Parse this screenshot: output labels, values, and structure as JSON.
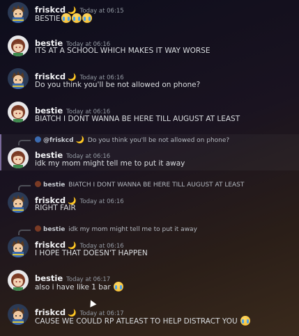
{
  "messages": [
    {
      "user": "friskcd",
      "moon": "🌙",
      "timestamp": "Today at 06:15",
      "text": "BESTIE",
      "emoji_count": 3
    },
    {
      "user": "bestie",
      "timestamp": "Today at 06:16",
      "text": "ITS AT A SCHOOL WHICH MAKES IT WAY WORSE"
    },
    {
      "user": "friskcd",
      "moon": "🌙",
      "timestamp": "Today at 06:16",
      "text": "Do you think you'll be not allowed on phone?"
    },
    {
      "user": "bestie",
      "timestamp": "Today at 06:16",
      "text": "BIATCH I DONT WANNA BE HERE TILL AUGUST AT LEAST"
    },
    {
      "reply_user": "@friskcd",
      "reply_moon": "🌙",
      "reply_text": "Do you think you'll be not allowed on phone?",
      "user": "bestie",
      "timestamp": "Today at 06:16",
      "text": "idk my mom might tell me to put it away"
    },
    {
      "reply_user": "bestie",
      "reply_text": "BIATCH I DONT WANNA BE HERE TILL AUGUST AT LEAST",
      "user": "friskcd",
      "moon": "🌙",
      "timestamp": "Today at 06:16",
      "text": "RIGHT FAIR"
    },
    {
      "reply_user": "bestie",
      "reply_text": "idk my mom might tell me to put it away",
      "user": "friskcd",
      "moon": "🌙",
      "timestamp": "Today at 06:16",
      "text": "I HOPE THAT DOESN'T HAPPEN"
    },
    {
      "user": "bestie",
      "timestamp": "Today at 06:17",
      "text": "also i have like 1 bar",
      "emoji_count": 1
    },
    {
      "user": "friskcd",
      "moon": "🌙",
      "timestamp": "Today at 06:17",
      "text": "CAUSE WE COULD RP ATLEAST TO HELP DISTRACT YOU",
      "emoji_count": 1
    }
  ],
  "colors": {
    "username": "#f2f3f5",
    "timestamp": "#949ba4",
    "text": "#dbdee1",
    "moon": "#f5c542"
  }
}
